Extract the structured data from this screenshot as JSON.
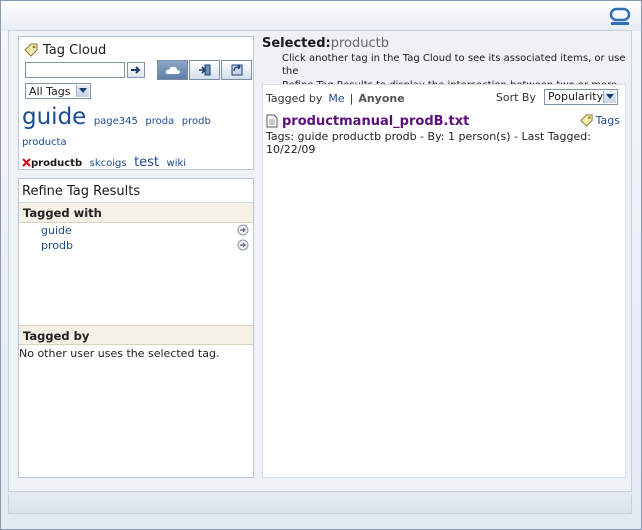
{
  "tag_cloud": {
    "title": "Tag Cloud",
    "search_value": "",
    "filter_select": "All Tags",
    "tags": [
      {
        "label": "guide",
        "size": "big"
      },
      {
        "label": "page345",
        "size": "sm"
      },
      {
        "label": "proda",
        "size": "sm"
      },
      {
        "label": "prodb",
        "size": "sm"
      },
      {
        "label": "producta",
        "size": "sm"
      },
      {
        "label": "productb",
        "size": "selected"
      },
      {
        "label": "skcoigs",
        "size": "sm"
      },
      {
        "label": "test",
        "size": "med"
      },
      {
        "label": "wiki",
        "size": "sm"
      }
    ]
  },
  "refine": {
    "title": "Refine Tag Results",
    "tagged_with_heading": "Tagged with",
    "tagged_with_items": [
      "guide",
      "prodb"
    ],
    "tagged_by_heading": "Tagged by",
    "tagged_by_message": "No other user uses the selected tag."
  },
  "selected": {
    "label": "Selected:",
    "value": "productb",
    "hint_line1": "Click another tag in the Tag Cloud to see its associated items, or use the",
    "hint_line2": "Refine Tag Results to display the intersection between two or more tags."
  },
  "filter": {
    "tagged_by_label": "Tagged by",
    "me_label": "Me",
    "separator": "|",
    "anyone_label": "Anyone",
    "sort_label": "Sort By",
    "sort_value": "Popularity"
  },
  "results": [
    {
      "title": "productmanual_prodB.txt",
      "tags_label": "Tags",
      "meta": "Tags: guide productb prodb - By: 1 person(s) - Last Tagged: 10/22/09"
    }
  ],
  "colors": {
    "link": "#1c4c8f",
    "result_link": "#5b0f7a",
    "section_header_bg": "#f5f1e6"
  }
}
